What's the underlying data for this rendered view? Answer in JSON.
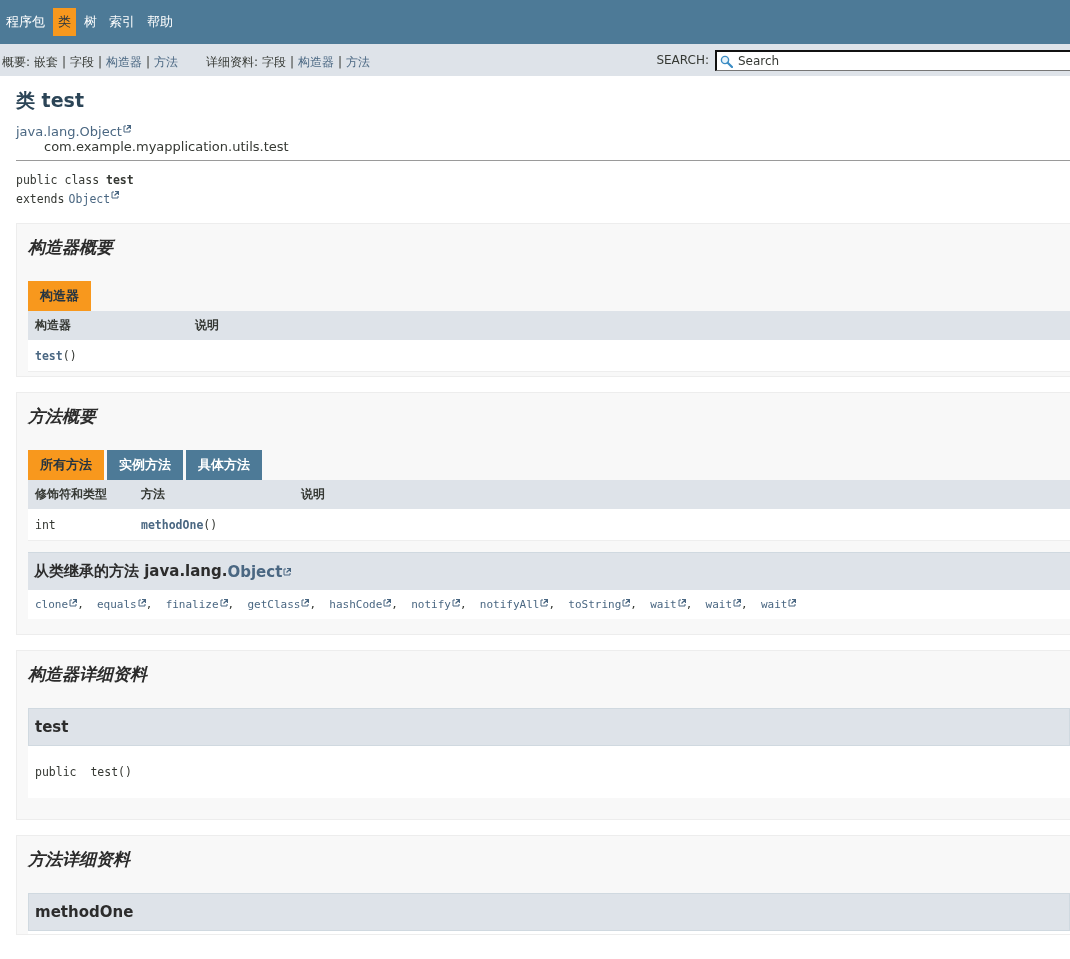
{
  "top_nav": [
    {
      "label": "程序包",
      "selected": false
    },
    {
      "label": "类",
      "selected": true
    },
    {
      "label": "树",
      "selected": false
    },
    {
      "label": "索引",
      "selected": false
    },
    {
      "label": "帮助",
      "selected": false
    }
  ],
  "sub_nav": {
    "groups": [
      {
        "label": "概要:",
        "items": [
          {
            "label": "嵌套",
            "enabled": false
          },
          {
            "label": "字段",
            "enabled": false
          },
          {
            "label": "构造器",
            "enabled": true
          },
          {
            "label": "方法",
            "enabled": true
          }
        ]
      },
      {
        "label": "详细资料:",
        "items": [
          {
            "label": "字段",
            "enabled": false
          },
          {
            "label": "构造器",
            "enabled": true
          },
          {
            "label": "方法",
            "enabled": true
          }
        ]
      }
    ],
    "separator": "|",
    "search": {
      "label": "SEARCH:",
      "placeholder": "Search"
    }
  },
  "header": {
    "title": "类 test",
    "inheritance": [
      "java.lang.Object",
      "com.example.myapplication.utils.test"
    ],
    "declaration": "public class **test**",
    "extends_label": "extends",
    "extends_link": "Object"
  },
  "sections": [
    {
      "kind": "summary",
      "title": "构造器概要",
      "tabs": [
        {
          "label": "构造器",
          "selected": true
        }
      ],
      "columns": [
        "构造器",
        "说明"
      ],
      "rows": [
        {
          "cells": [
            {
              "link": "test",
              "text": "()"
            }
          ]
        }
      ]
    },
    {
      "kind": "summary",
      "title": "方法概要",
      "tabs": [
        {
          "label": "所有方法",
          "selected": true
        },
        {
          "label": "实例方法",
          "selected": false
        },
        {
          "label": "具体方法",
          "selected": false
        }
      ],
      "columns": [
        "修饰符和类型",
        "方法",
        "说明"
      ],
      "rows": [
        {
          "cells": [
            {
              "text": "int"
            },
            {
              "link": "methodOne",
              "text": "()"
            }
          ]
        }
      ],
      "inherited": {
        "title": "从类继承的方法 java.lang.",
        "link": "Object",
        "separator": ",",
        "methods": [
          "clone",
          "equals",
          "finalize",
          "getClass",
          "hashCode",
          "notify",
          "notifyAll",
          "toString",
          "wait",
          "wait",
          "wait"
        ]
      }
    },
    {
      "kind": "detail",
      "title": "构造器详细资料",
      "members": [
        {
          "name": "test",
          "signature": "public  test()"
        }
      ]
    },
    {
      "kind": "detail",
      "title": "方法详细资料",
      "members": [
        {
          "name": "methodOne"
        }
      ]
    }
  ]
}
